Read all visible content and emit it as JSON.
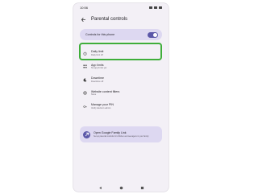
{
  "status_bar": {
    "time": "10:56"
  },
  "header": {
    "title": "Parental controls"
  },
  "toggle": {
    "label": "Controls for this phone",
    "on": true
  },
  "items": [
    {
      "title": "Daily limit",
      "subtitle": "Daily limit off",
      "icon": "timer-icon"
    },
    {
      "title": "App limits",
      "subtitle": "No app limits yet",
      "icon": "apps-icon"
    },
    {
      "title": "Downtime",
      "subtitle": "Downtime off",
      "icon": "moon-icon"
    },
    {
      "title": "Website content filters",
      "subtitle": "None",
      "icon": "filter-icon"
    },
    {
      "title": "Manage your PIN",
      "subtitle": "Verify device's admin",
      "icon": "pin-icon"
    }
  ],
  "family_link": {
    "title": "Open Google Family Link",
    "subtitle": "Set up parental controls for children and teenagers in your family",
    "icon": "family-link-icon"
  },
  "colors": {
    "accent": "#5b57a8",
    "card": "#ddd8f1",
    "highlight": "#3fae3a",
    "background": "#f3f0f6"
  }
}
